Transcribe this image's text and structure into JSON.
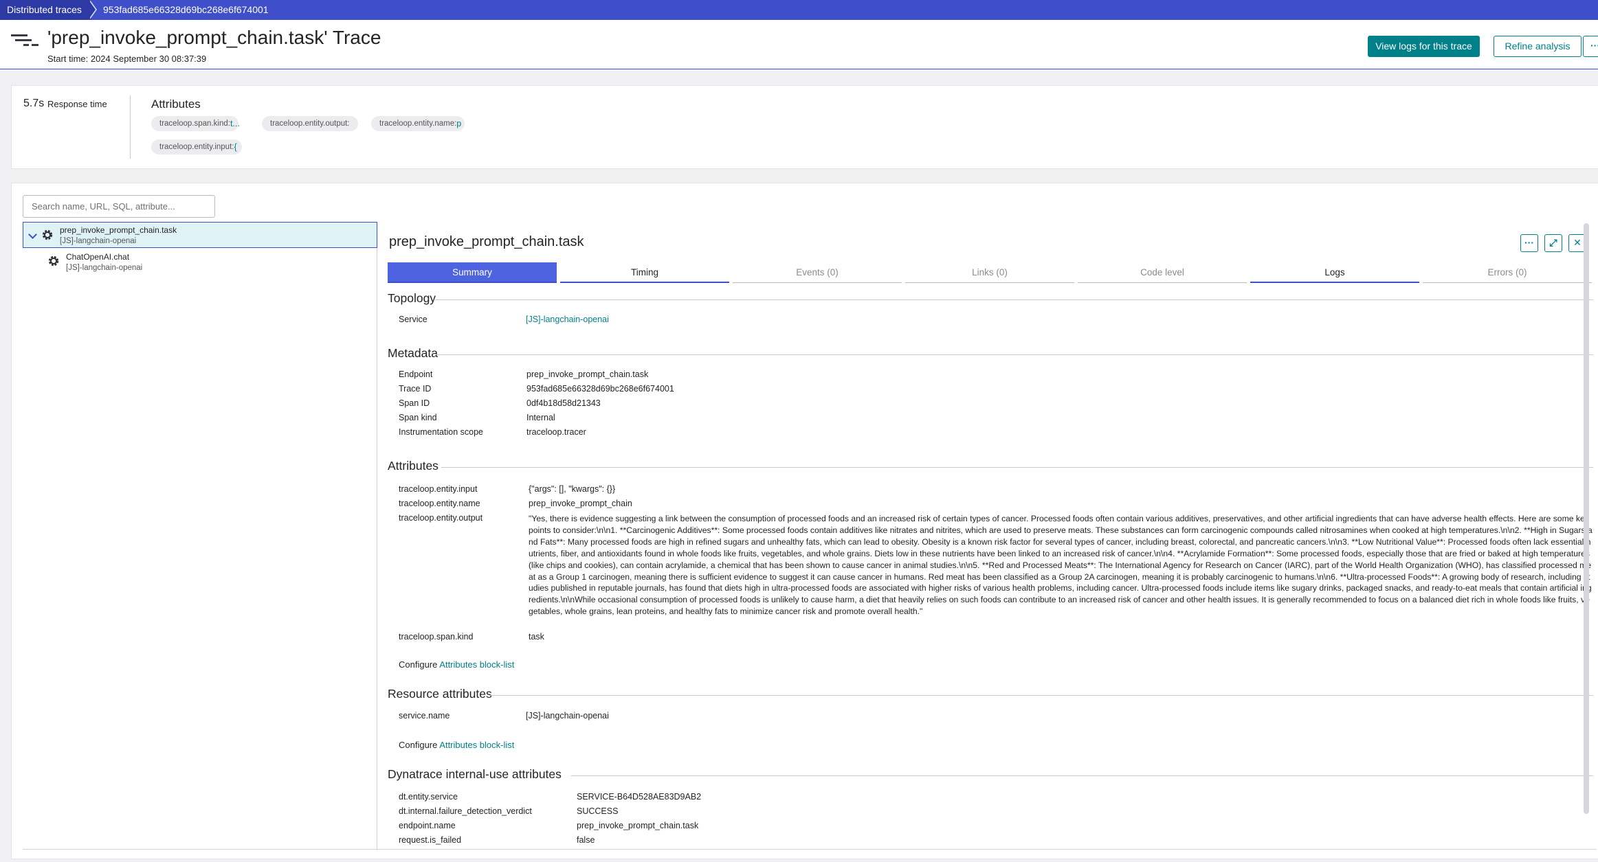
{
  "breadcrumb": {
    "root": "Distributed traces",
    "current": "953fad685e66328d69bc268e6f674001"
  },
  "header": {
    "title": "'prep_invoke_prompt_chain.task' Trace",
    "start_time": "Start time: 2024 September 30 08:37:39",
    "view_logs_label": "View logs for this trace",
    "refine_label": "Refine analysis",
    "more_label": "···",
    "accent_color": "#3e4fc9",
    "button_color": "#00818a"
  },
  "summary": {
    "response_value": "5.7s",
    "response_label": "Response time",
    "attributes_title": "Attributes",
    "chips": [
      {
        "key": "traceloop.span.kind:",
        "value": "t..."
      },
      {
        "key": "traceloop.entity.output:",
        "value": ""
      },
      {
        "key": "traceloop.entity.name:",
        "value": "p"
      },
      {
        "key": "traceloop.entity.input:",
        "value": "{"
      }
    ]
  },
  "search": {
    "placeholder": "Search name, URL, SQL, attribute..."
  },
  "tree": [
    {
      "name": "prep_invoke_prompt_chain.task",
      "service": "[JS]-langchain-openai",
      "icon": "gear-icon",
      "selected": true
    },
    {
      "name": "ChatOpenAI.chat",
      "service": "[JS]-langchain-openai",
      "icon": "gear-icon",
      "selected": false
    }
  ],
  "detail": {
    "title": "prep_invoke_prompt_chain.task",
    "buttons": {
      "more": "···",
      "expand": "⤢",
      "close": "✕"
    },
    "tabs": [
      {
        "label": "Summary",
        "state": "active"
      },
      {
        "label": "Timing",
        "state": "enabled"
      },
      {
        "label": "Events (0)",
        "state": "disabled"
      },
      {
        "label": "Links (0)",
        "state": "disabled"
      },
      {
        "label": "Code level",
        "state": "disabled"
      },
      {
        "label": "Logs",
        "state": "enabled"
      },
      {
        "label": "Errors (0)",
        "state": "disabled"
      }
    ],
    "topology": {
      "title": "Topology",
      "service_key": "Service",
      "service_value": "[JS]-langchain-openai"
    },
    "metadata": {
      "title": "Metadata",
      "rows": [
        {
          "k": "Endpoint",
          "v": "prep_invoke_prompt_chain.task"
        },
        {
          "k": "Trace ID",
          "v": "953fad685e66328d69bc268e6f674001"
        },
        {
          "k": "Span ID",
          "v": "0df4b18d58d21343"
        },
        {
          "k": "Span kind",
          "v": "Internal"
        },
        {
          "k": "Instrumentation scope",
          "v": "traceloop.tracer"
        }
      ]
    },
    "attributes": {
      "title": "Attributes",
      "input_key": "traceloop.entity.input",
      "input_value": "{\"args\": [], \"kwargs\": {}}",
      "name_key": "traceloop.entity.name",
      "name_value": "prep_invoke_prompt_chain",
      "output_key": "traceloop.entity.output",
      "output_value": "\"Yes, there is evidence suggesting a link between the consumption of processed foods and an increased risk of certain types of cancer. Processed foods often contain various additives, preservatives, and other artificial ingredients that can have adverse health effects. Here are some key points to consider:\\n\\n1. **Carcinogenic Additives**: Some processed foods contain additives like nitrates and nitrites, which are used to preserve meats. These substances can form carcinogenic compounds called nitrosamines when cooked at high temperatures.\\n\\n2. **High in Sugars and Fats**: Many processed foods are high in refined sugars and unhealthy fats, which can lead to obesity. Obesity is a known risk factor for several types of cancer, including breast, colorectal, and pancreatic cancers.\\n\\n3. **Low Nutritional Value**: Processed foods often lack essential nutrients, fiber, and antioxidants found in whole foods like fruits, vegetables, and whole grains. Diets low in these nutrients have been linked to an increased risk of cancer.\\n\\n4. **Acrylamide Formation**: Some processed foods, especially those that are fried or baked at high temperatures (like chips and cookies), can contain acrylamide, a chemical that has been shown to cause cancer in animal studies.\\n\\n5. **Red and Processed Meats**: The International Agency for Research on Cancer (IARC), part of the World Health Organization (WHO), has classified processed meat as a Group 1 carcinogen, meaning there is sufficient evidence to suggest it can cause cancer in humans. Red meat has been classified as a Group 2A carcinogen, meaning it is probably carcinogenic to humans.\\n\\n6. **Ultra-processed Foods**: A growing body of research, including studies published in reputable journals, has found that diets high in ultra-processed foods are associated with higher risks of various health problems, including cancer. Ultra-processed foods include items like sugary drinks, packaged snacks, and ready-to-eat meals that contain artificial ingredients.\\n\\nWhile occasional consumption of processed foods is unlikely to cause harm, a diet that heavily relies on such foods can contribute to an increased risk of cancer and other health issues. It is generally recommended to focus on a balanced diet rich in whole foods like fruits, vegetables, whole grains, lean proteins, and healthy fats to minimize cancer risk and promote overall health.\"",
      "kind_key": "traceloop.span.kind",
      "kind_value": "task",
      "configure_label": "Configure",
      "blocklist_label": "Attributes block-list"
    },
    "resource": {
      "title": "Resource attributes",
      "service_key": "service.name",
      "service_value": "[JS]-langchain-openai",
      "configure_label": "Configure",
      "blocklist_label": "Attributes block-list"
    },
    "internal": {
      "title": "Dynatrace internal-use attributes",
      "rows": [
        {
          "k": "dt.entity.service",
          "v": "SERVICE-B64D528AE83D9AB2"
        },
        {
          "k": "dt.internal.failure_detection_verdict",
          "v": "SUCCESS"
        },
        {
          "k": "endpoint.name",
          "v": "prep_invoke_prompt_chain.task"
        },
        {
          "k": "request.is_failed",
          "v": "false"
        }
      ]
    }
  }
}
